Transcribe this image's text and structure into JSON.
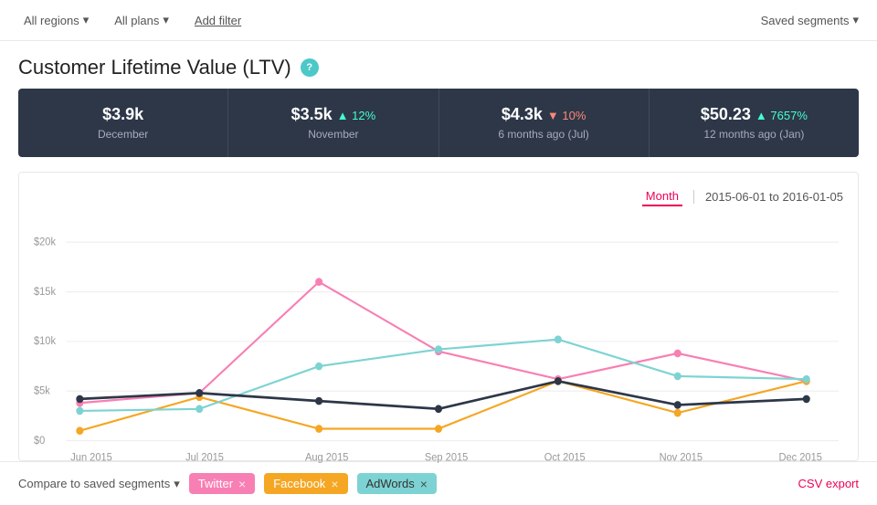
{
  "topbar": {
    "filter1": "All regions",
    "filter2": "All plans",
    "add_filter": "Add filter",
    "saved_segments": "Saved segments"
  },
  "page": {
    "title": "Customer Lifetime Value (LTV)",
    "help_icon": "?"
  },
  "metrics": [
    {
      "value": "$3.9k",
      "label": "December",
      "change": null,
      "direction": null
    },
    {
      "value": "$3.5k",
      "label": "November",
      "change": "12%",
      "direction": "up"
    },
    {
      "value": "$4.3k",
      "label": "6 months ago (Jul)",
      "change": "10%",
      "direction": "down"
    },
    {
      "value": "$50.23",
      "label": "12 months ago (Jan)",
      "change": "7657%",
      "direction": "up"
    }
  ],
  "chart": {
    "time_btn": "Month",
    "date_range": "2015-06-01 to 2016-01-05",
    "x_labels": [
      "Jun 2015",
      "Jul 2015",
      "Aug 2015",
      "Sep 2015",
      "Oct 2015",
      "Nov 2015",
      "Dec 2015"
    ],
    "y_labels": [
      "$0",
      "$5k",
      "$10k",
      "$15k",
      "$20k"
    ],
    "series": {
      "twitter": {
        "color": "#f87fb3",
        "points": [
          3800,
          4800,
          16000,
          9000,
          6200,
          8800,
          6000
        ]
      },
      "facebook": {
        "color": "#f5a623",
        "points": [
          1000,
          4400,
          1200,
          1200,
          6000,
          2800,
          6000
        ]
      },
      "adwords": {
        "color": "#7dd3d3",
        "points": [
          3000,
          3200,
          7500,
          9200,
          10200,
          6500,
          6200
        ]
      },
      "main": {
        "color": "#2d3748",
        "points": [
          4200,
          4800,
          4000,
          3200,
          6000,
          3600,
          4200
        ]
      }
    }
  },
  "footer": {
    "compare_label": "Compare to saved segments",
    "segments": [
      {
        "label": "Twitter",
        "class": "tag-twitter"
      },
      {
        "label": "Facebook",
        "class": "tag-facebook"
      },
      {
        "label": "AdWords",
        "class": "tag-adwords"
      }
    ],
    "csv_export": "CSV export"
  }
}
